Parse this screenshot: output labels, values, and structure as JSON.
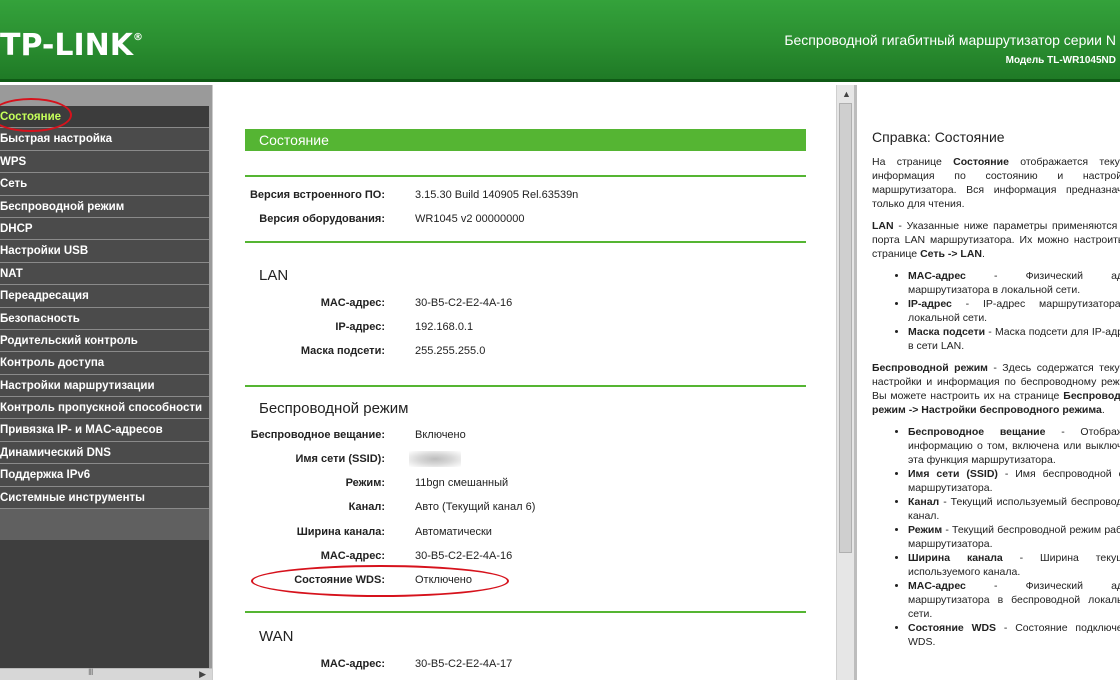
{
  "header": {
    "logo": "TP-LINK",
    "logo_mark": "®",
    "title": "Беспроводной гигабитный маршрутизатор серии N",
    "model": "Модель TL-WR1045ND"
  },
  "menu": {
    "items": [
      {
        "label": "Состояние",
        "active": true
      },
      {
        "label": "Быстрая настройка"
      },
      {
        "label": "WPS"
      },
      {
        "label": "Сеть"
      },
      {
        "label": "Беспроводной режим"
      },
      {
        "label": "DHCP"
      },
      {
        "label": "Настройки USB"
      },
      {
        "label": "NAT"
      },
      {
        "label": "Переадресация"
      },
      {
        "label": "Безопасность"
      },
      {
        "label": "Родительский контроль"
      },
      {
        "label": "Контроль доступа"
      },
      {
        "label": "Настройки маршрутизации"
      },
      {
        "label": "Контроль пропускной способности"
      },
      {
        "label": "Привязка IP- и MAC-адресов"
      },
      {
        "label": "Динамический DNS"
      },
      {
        "label": "Поддержка IPv6"
      },
      {
        "label": "Системные инструменты"
      }
    ],
    "scroll_mid": "III"
  },
  "status": {
    "title": "Состояние",
    "firmware_label": "Версия встроенного ПО:",
    "firmware_value": "3.15.30 Build 140905 Rel.63539n",
    "hardware_label": "Версия оборудования:",
    "hardware_value": "WR1045 v2 00000000",
    "lan": {
      "title": "LAN",
      "mac_label": "MAC-адрес:",
      "mac_value": "30-B5-C2-E2-4A-16",
      "ip_label": "IP-адрес:",
      "ip_value": "192.168.0.1",
      "mask_label": "Маска подсети:",
      "mask_value": "255.255.255.0"
    },
    "wireless": {
      "title": "Беспроводной режим",
      "broadcast_label": "Беспроводное вещание:",
      "broadcast_value": "Включено",
      "ssid_label": "Имя сети (SSID):",
      "mode_label": "Режим:",
      "mode_value": "11bgn смешанный",
      "channel_label": "Канал:",
      "channel_value": "Авто (Текущий канал 6)",
      "width_label": "Ширина канала:",
      "width_value": "Автоматически",
      "mac_label": "MAC-адрес:",
      "mac_value": "30-B5-C2-E2-4A-16",
      "wds_label": "Состояние WDS:",
      "wds_value": "Отключено"
    },
    "wan": {
      "title": "WAN",
      "mac_label": "MAC-адрес:",
      "mac_value": "30-B5-C2-E2-4A-17"
    }
  },
  "help": {
    "title": "Справка: Состояние",
    "p1_a": "На странице ",
    "p1_b": "Состояние",
    "p1_c": " отображается текущая информация по состоянию и настройкам маршрутизатора. Вся информация предназначена только для чтения.",
    "p2_a": "LAN",
    "p2_b": " - Указанные ниже параметры применяются для порта LAN маршрутизатора. Их можно настроить на странице ",
    "p2_c": "Сеть -> LAN",
    "p2_d": ".",
    "lan_items": [
      {
        "term": "MAC-адрес",
        "desc": " - Физический адрес маршрутизатора в локальной сети."
      },
      {
        "term": "IP-адрес",
        "desc": " - IP-адрес маршрутизатора в локальной сети."
      },
      {
        "term": "Маска подсети",
        "desc": " - Маска подсети для IP-адреса в сети LAN."
      }
    ],
    "p3_a": "Беспроводной режим",
    "p3_b": " - Здесь содержатся текущие настройки и информация по беспроводному режиму. Вы можете настроить их на странице ",
    "p3_c": "Беспроводной режим -> Настройки беспроводного режима",
    "p3_d": ".",
    "wl_items": [
      {
        "term": "Беспроводное вещание",
        "desc": " - Отображает информацию о том, включена или выключена эта функция маршрутизатора."
      },
      {
        "term": "Имя сети (SSID)",
        "desc": " - Имя беспроводной сети маршрутизатора."
      },
      {
        "term": "Канал",
        "desc": " - Текущий используемый беспроводной канал."
      },
      {
        "term": "Режим",
        "desc": " - Текущий беспроводной режим работы маршрутизатора."
      },
      {
        "term": "Ширина канала",
        "desc": " - Ширина текущего используемого канала."
      },
      {
        "term": "MAC-адрес",
        "desc": " - Физический адрес маршрутизатора в беспроводной локальной сети."
      },
      {
        "term": "Состояние WDS",
        "desc": " - Состояние подключения WDS."
      }
    ]
  },
  "colors": {
    "brand_green": "#55b533",
    "highlight_red": "#d6121c",
    "menu_active": "#c5ff5a"
  }
}
